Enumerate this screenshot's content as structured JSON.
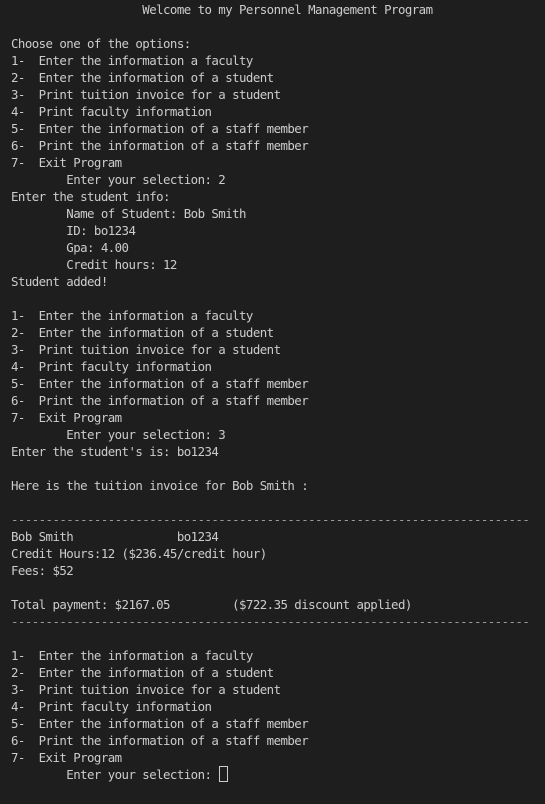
{
  "terminal": {
    "lines": [
      {
        "text": "                   Welcome to my Personnel Management Program"
      },
      {
        "text": ""
      },
      {
        "text": "Choose one of the options:"
      },
      {
        "text": "1-  Enter the information a faculty"
      },
      {
        "text": "2-  Enter the information of a student"
      },
      {
        "text": "3-  Print tuition invoice for a student"
      },
      {
        "text": "4-  Print faculty information"
      },
      {
        "text": "5-  Enter the information of a staff member"
      },
      {
        "text": "6-  Print the information of a staff member"
      },
      {
        "text": "7-  Exit Program"
      },
      {
        "text": "        Enter your selection: 2"
      },
      {
        "text": "Enter the student info:"
      },
      {
        "text": "        Name of Student: Bob Smith"
      },
      {
        "text": "        ID: bo1234"
      },
      {
        "text": "        Gpa: 4.00"
      },
      {
        "text": "        Credit hours: 12"
      },
      {
        "text": "Student added!"
      },
      {
        "text": ""
      },
      {
        "text": "1-  Enter the information a faculty"
      },
      {
        "text": "2-  Enter the information of a student"
      },
      {
        "text": "3-  Print tuition invoice for a student"
      },
      {
        "text": "4-  Print faculty information"
      },
      {
        "text": "5-  Enter the information of a staff member"
      },
      {
        "text": "6-  Print the information of a staff member"
      },
      {
        "text": "7-  Exit Program"
      },
      {
        "text": "        Enter your selection: 3"
      },
      {
        "text": "Enter the student's is: bo1234"
      },
      {
        "text": ""
      },
      {
        "text": "Here is the tuition invoice for Bob Smith :"
      },
      {
        "text": ""
      },
      {
        "text": "---------------------------------------------------------------------------",
        "kind": "sep"
      },
      {
        "text": "Bob Smith               bo1234"
      },
      {
        "text": "Credit Hours:12 ($236.45/credit hour)"
      },
      {
        "text": "Fees: $52"
      },
      {
        "text": ""
      },
      {
        "text": "Total payment: $2167.05         ($722.35 discount applied)"
      },
      {
        "text": "---------------------------------------------------------------------------",
        "kind": "sep"
      },
      {
        "text": ""
      },
      {
        "text": "1-  Enter the information a faculty"
      },
      {
        "text": "2-  Enter the information of a student"
      },
      {
        "text": "3-  Print tuition invoice for a student"
      },
      {
        "text": "4-  Print faculty information"
      },
      {
        "text": "5-  Enter the information of a staff member"
      },
      {
        "text": "6-  Print the information of a staff member"
      },
      {
        "text": "7-  Exit Program"
      },
      {
        "text": "        Enter your selection: ",
        "cursor": true
      }
    ]
  }
}
